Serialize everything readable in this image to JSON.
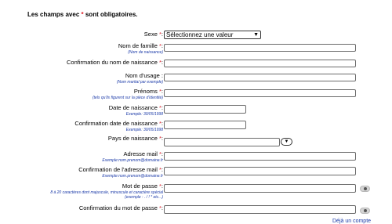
{
  "top_fragment": "...",
  "notice": {
    "prefix": "Les champs avec",
    "star": "*",
    "suffix": "sont obligatoires."
  },
  "required_star": "*",
  "fields": {
    "sexe": {
      "label": "Sexe",
      "select_value": "Sélectionnez une valeur"
    },
    "nom_famille": {
      "label": "Nom de famille",
      "hint": "(Nom de naissance)"
    },
    "confirm_nom": {
      "label": "Confirmation du nom de naissance"
    },
    "nom_usage": {
      "label": "Nom d'usage",
      "hint": "(Nom marital par exemple)"
    },
    "prenoms": {
      "label": "Prénoms",
      "hint": "(tels qu'ils figurent sur la pièce d'identité)"
    },
    "date_naissance": {
      "label": "Date de naissance",
      "hint": "Exemple: 30/05/1998"
    },
    "confirm_date": {
      "label": "Confirmation date de naissance",
      "hint": "Exemple: 30/05/1998"
    },
    "pays": {
      "label": "Pays de naissance"
    },
    "email": {
      "label": "Adresse mail",
      "hint": "Exemple:nom.prenom@domaine.fr"
    },
    "confirm_email": {
      "label": "Confirmation de l'adresse mail",
      "hint": "Exemple:nom.prenom@domaine.fr"
    },
    "mdp": {
      "label": "Mot de passe",
      "hint1": "8 à 20 caractères dont majuscule, minuscule et caractère spécial",
      "hint2": "(exemple : . / ! * etc...)"
    },
    "confirm_mdp": {
      "label": "Confirmation du mot de passe"
    }
  },
  "bottom_link": "Déjà un compte",
  "colors": {
    "required": "#e0202a",
    "hint": "#1b3aa8"
  }
}
